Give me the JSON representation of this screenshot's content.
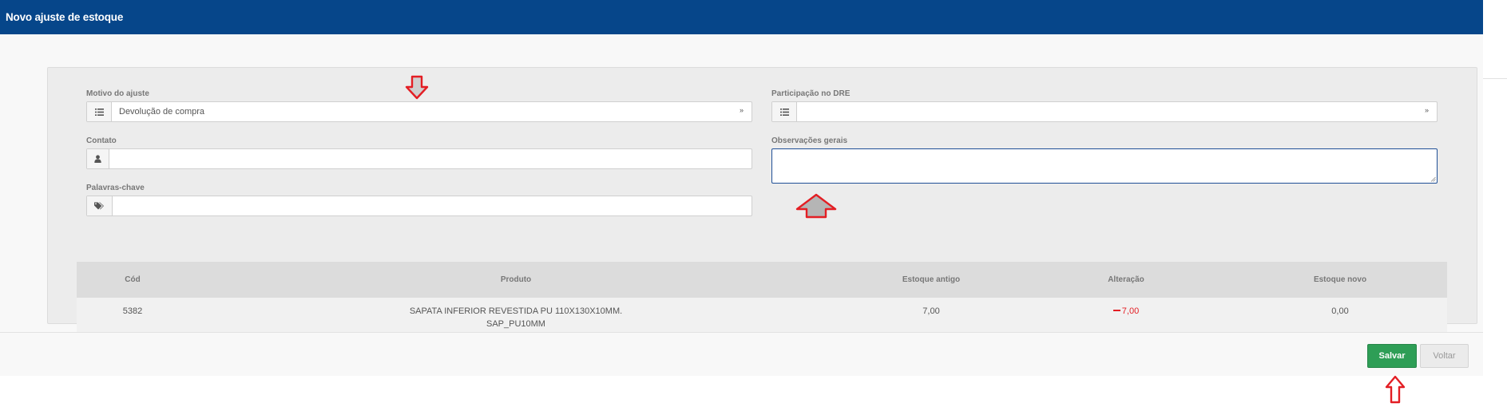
{
  "header": {
    "title": "Novo ajuste de estoque"
  },
  "form": {
    "motivo": {
      "label": "Motivo do ajuste",
      "value": "Devolução de compra",
      "icon": "list-icon"
    },
    "participacao": {
      "label": "Participação no DRE",
      "value": "",
      "icon": "list-icon"
    },
    "contato": {
      "label": "Contato",
      "value": "",
      "icon": "user-icon"
    },
    "observacoes": {
      "label": "Observações gerais",
      "value": ""
    },
    "palavras": {
      "label": "Palavras-chave",
      "value": "",
      "icon": "tags-icon"
    }
  },
  "table": {
    "headers": {
      "cod": "Cód",
      "produto": "Produto",
      "estoque_antigo": "Estoque antigo",
      "alteracao": "Alteração",
      "estoque_novo": "Estoque novo"
    },
    "rows": [
      {
        "cod": "5382",
        "produto_line1": "SAPATA INFERIOR REVESTIDA PU 110X130X10MM.",
        "produto_line2": "SAP_PU10MM",
        "estoque_antigo": "7,00",
        "alteracao": "7,00",
        "estoque_novo": "0,00"
      }
    ]
  },
  "footer": {
    "save_label": "Salvar",
    "back_label": "Voltar"
  },
  "colors": {
    "header_bg": "#06468a",
    "save_bg": "#2e9e56",
    "negative": "#e31e24",
    "annotation_arrow": "#e31e24"
  }
}
